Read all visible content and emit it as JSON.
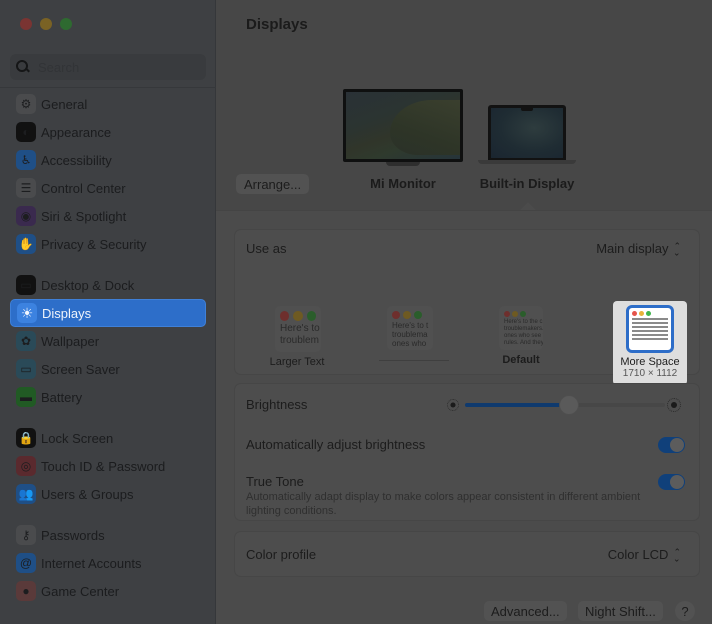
{
  "window": {
    "controls": [
      "close",
      "minimize",
      "zoom"
    ]
  },
  "sidebar": {
    "search_placeholder": "Search",
    "items": [
      {
        "label": "General",
        "icon": "gear-icon",
        "glyph": "⚙",
        "color": "#4a4b4d"
      },
      {
        "label": "Appearance",
        "icon": "appearance-icon",
        "glyph": "◐",
        "color": "#111111"
      },
      {
        "label": "Accessibility",
        "icon": "accessibility-icon",
        "glyph": "♿",
        "color": "#1f4f86"
      },
      {
        "label": "Control Center",
        "icon": "control-center-icon",
        "glyph": "☰",
        "color": "#4a4b4d"
      },
      {
        "label": "Siri & Spotlight",
        "icon": "siri-icon",
        "glyph": "◉",
        "color": "#3a2a4e"
      },
      {
        "label": "Privacy & Security",
        "icon": "hand-icon",
        "glyph": "✋",
        "color": "#1f4f86"
      },
      {
        "label": "Desktop & Dock",
        "icon": "dock-icon",
        "glyph": "▭",
        "color": "#111111"
      },
      {
        "label": "Displays",
        "icon": "sun-icon",
        "glyph": "☀",
        "color": "#3c82e0",
        "active": true
      },
      {
        "label": "Wallpaper",
        "icon": "wallpaper-icon",
        "glyph": "✿",
        "color": "#2a4a58"
      },
      {
        "label": "Screen Saver",
        "icon": "screen-saver-icon",
        "glyph": "▭",
        "color": "#2a4a58"
      },
      {
        "label": "Battery",
        "icon": "battery-icon",
        "glyph": "▬",
        "color": "#215a24"
      },
      {
        "label": "Lock Screen",
        "icon": "lock-icon",
        "glyph": "🔒",
        "color": "#111111"
      },
      {
        "label": "Touch ID & Password",
        "icon": "fingerprint-icon",
        "glyph": "◎",
        "color": "#5a2a2e"
      },
      {
        "label": "Users & Groups",
        "icon": "users-icon",
        "glyph": "👥",
        "color": "#1f4f86"
      },
      {
        "label": "Passwords",
        "icon": "key-icon",
        "glyph": "⚷",
        "color": "#4a4b4d"
      },
      {
        "label": "Internet Accounts",
        "icon": "at-icon",
        "glyph": "@",
        "color": "#1f4f86"
      },
      {
        "label": "Game Center",
        "icon": "game-center-icon",
        "glyph": "●",
        "color": "#5a3a3a"
      }
    ]
  },
  "main": {
    "title": "Displays",
    "arrange_label": "Arrange...",
    "displays": [
      {
        "name": "Mi Monitor"
      },
      {
        "name": "Built-in Display",
        "selected": true
      }
    ],
    "use_as": {
      "label": "Use as",
      "value": "Main display"
    },
    "resolutions": [
      {
        "label": "Larger Text",
        "sample": "Here's to\ntroublem"
      },
      {
        "label": "",
        "sample": "Here's to t\ntroublema\nones who"
      },
      {
        "label": "Default",
        "sample": "Here's to the c\ntroublemakers.\nones who see t\nrules. And they"
      },
      {
        "label": "More Space",
        "detail": "1710 × 1112",
        "selected": true
      }
    ],
    "brightness": {
      "label": "Brightness",
      "value": 0.52
    },
    "auto_brightness": {
      "label": "Automatically adjust brightness",
      "on": true
    },
    "true_tone": {
      "label": "True Tone",
      "description": "Automatically adapt display to make colors appear consistent in different ambient lighting conditions.",
      "on": true
    },
    "color_profile": {
      "label": "Color profile",
      "value": "Color LCD"
    },
    "buttons": {
      "advanced": "Advanced...",
      "night_shift": "Night Shift...",
      "help": "?"
    }
  }
}
